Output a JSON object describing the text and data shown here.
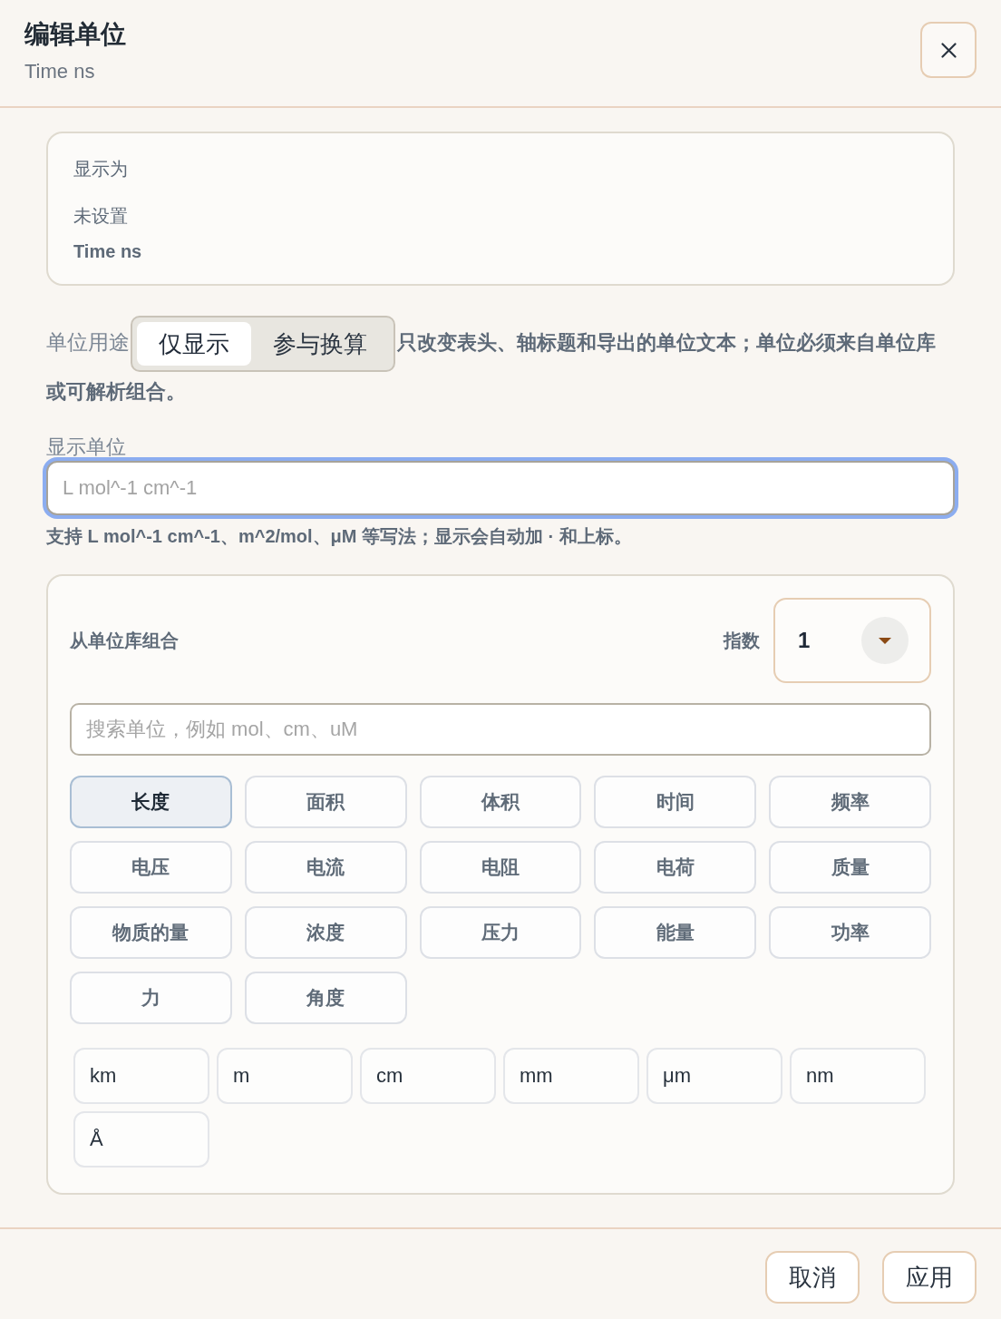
{
  "dialog": {
    "title": "编辑单位",
    "subtitle": "Time ns"
  },
  "display_card": {
    "heading": "显示为",
    "status": "未设置",
    "value": "Time ns"
  },
  "unit_usage": {
    "label": "单位用途",
    "options": [
      {
        "label": "仅显示",
        "selected": true
      },
      {
        "label": "参与换算",
        "selected": false
      }
    ],
    "note_lines": [
      "只改变表头、轴标题和导出的单位文本；单位必须来自单位库",
      "或可解析组合。"
    ]
  },
  "display_unit": {
    "label": "显示单位",
    "placeholder": "L mol^-1 cm^-1",
    "focused": true,
    "hint": "支持 L mol^-1 cm^-1、m^2/mol、μM 等写法；显示会自动加 · 和上标。"
  },
  "library": {
    "title": "从单位库组合",
    "exponent": {
      "label": "指数",
      "value": "1"
    },
    "search": {
      "placeholder": "搜索单位，例如 mol、cm、uM"
    },
    "categories": [
      {
        "label": "长度",
        "selected": true
      },
      {
        "label": "面积",
        "selected": false
      },
      {
        "label": "体积",
        "selected": false
      },
      {
        "label": "时间",
        "selected": false
      },
      {
        "label": "频率",
        "selected": false
      },
      {
        "label": "电压",
        "selected": false
      },
      {
        "label": "电流",
        "selected": false
      },
      {
        "label": "电阻",
        "selected": false
      },
      {
        "label": "电荷",
        "selected": false
      },
      {
        "label": "质量",
        "selected": false
      },
      {
        "label": "物质的量",
        "selected": false
      },
      {
        "label": "浓度",
        "selected": false
      },
      {
        "label": "压力",
        "selected": false
      },
      {
        "label": "能量",
        "selected": false
      },
      {
        "label": "功率",
        "selected": false
      },
      {
        "label": "力",
        "selected": false
      },
      {
        "label": "角度",
        "selected": false
      }
    ],
    "units": [
      "km",
      "m",
      "cm",
      "mm",
      "μm",
      "nm",
      "Å"
    ]
  },
  "buttons": [
    {
      "label": "取消"
    },
    {
      "label": "应用"
    }
  ]
}
